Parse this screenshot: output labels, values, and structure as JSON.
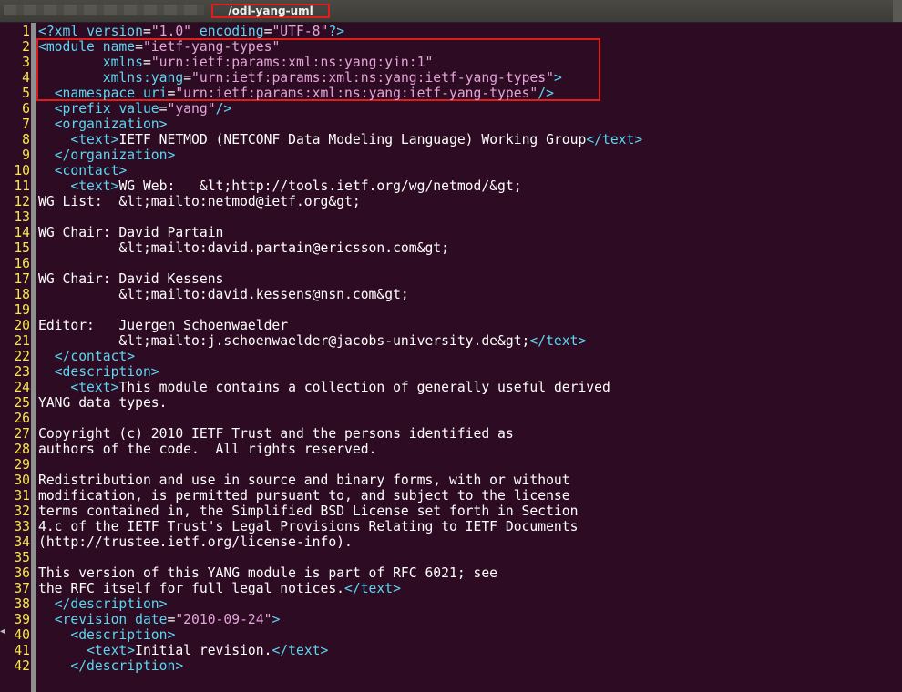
{
  "window": {
    "title": "/odl-yang-uml"
  },
  "lines": [
    {
      "n": "1",
      "parts": [
        [
          "pi",
          "<?xml "
        ],
        [
          "attr",
          "version"
        ],
        [
          "txt",
          "="
        ],
        [
          "str",
          "\"1.0\""
        ],
        [
          "txt",
          " "
        ],
        [
          "attr",
          "encoding"
        ],
        [
          "txt",
          "="
        ],
        [
          "str",
          "\"UTF-8\""
        ],
        [
          "pi",
          "?>"
        ]
      ]
    },
    {
      "n": "2",
      "parts": [
        [
          "tag",
          "<module "
        ],
        [
          "attr",
          "name"
        ],
        [
          "txt",
          "="
        ],
        [
          "str",
          "\"ietf-yang-types\""
        ]
      ]
    },
    {
      "n": "3",
      "parts": [
        [
          "txt",
          "        "
        ],
        [
          "attr",
          "xmlns"
        ],
        [
          "txt",
          "="
        ],
        [
          "str",
          "\"urn:ietf:params:xml:ns:yang:yin:1\""
        ]
      ]
    },
    {
      "n": "4",
      "parts": [
        [
          "txt",
          "        "
        ],
        [
          "attr",
          "xmlns:yang"
        ],
        [
          "txt",
          "="
        ],
        [
          "str",
          "\"urn:ietf:params:xml:ns:yang:ietf-yang-types\""
        ],
        [
          "tag",
          ">"
        ]
      ]
    },
    {
      "n": "5",
      "parts": [
        [
          "txt",
          "  "
        ],
        [
          "tag",
          "<namespace "
        ],
        [
          "attr",
          "uri"
        ],
        [
          "txt",
          "="
        ],
        [
          "str",
          "\"urn:ietf:params:xml:ns:yang:ietf-yang-types\""
        ],
        [
          "tag",
          "/>"
        ]
      ]
    },
    {
      "n": "6",
      "parts": [
        [
          "txt",
          "  "
        ],
        [
          "tag",
          "<prefix "
        ],
        [
          "attr",
          "value"
        ],
        [
          "txt",
          "="
        ],
        [
          "str",
          "\"yang\""
        ],
        [
          "tag",
          "/>"
        ]
      ]
    },
    {
      "n": "7",
      "parts": [
        [
          "txt",
          "  "
        ],
        [
          "tag",
          "<organization>"
        ]
      ]
    },
    {
      "n": "8",
      "parts": [
        [
          "txt",
          "    "
        ],
        [
          "tag",
          "<text>"
        ],
        [
          "txt",
          "IETF NETMOD (NETCONF Data Modeling Language) Working Group"
        ],
        [
          "tag",
          "</text>"
        ]
      ]
    },
    {
      "n": "9",
      "parts": [
        [
          "txt",
          "  "
        ],
        [
          "tag",
          "</organization>"
        ]
      ]
    },
    {
      "n": "10",
      "parts": [
        [
          "txt",
          "  "
        ],
        [
          "tag",
          "<contact>"
        ]
      ]
    },
    {
      "n": "11",
      "parts": [
        [
          "txt",
          "    "
        ],
        [
          "tag",
          "<text>"
        ],
        [
          "txt",
          "WG Web:   &lt;http://tools.ietf.org/wg/netmod/&gt;"
        ]
      ]
    },
    {
      "n": "12",
      "parts": [
        [
          "txt",
          "WG List:  &lt;mailto:netmod@ietf.org&gt;"
        ]
      ]
    },
    {
      "n": "13",
      "parts": [
        [
          "txt",
          ""
        ]
      ]
    },
    {
      "n": "14",
      "parts": [
        [
          "txt",
          "WG Chair: David Partain"
        ]
      ]
    },
    {
      "n": "15",
      "parts": [
        [
          "txt",
          "          &lt;mailto:david.partain@ericsson.com&gt;"
        ]
      ]
    },
    {
      "n": "16",
      "parts": [
        [
          "txt",
          ""
        ]
      ]
    },
    {
      "n": "17",
      "parts": [
        [
          "txt",
          "WG Chair: David Kessens"
        ]
      ]
    },
    {
      "n": "18",
      "parts": [
        [
          "txt",
          "          &lt;mailto:david.kessens@nsn.com&gt;"
        ]
      ]
    },
    {
      "n": "19",
      "parts": [
        [
          "txt",
          ""
        ]
      ]
    },
    {
      "n": "20",
      "parts": [
        [
          "txt",
          "Editor:   Juergen Schoenwaelder"
        ]
      ]
    },
    {
      "n": "21",
      "parts": [
        [
          "txt",
          "          &lt;mailto:j.schoenwaelder@jacobs-university.de&gt;"
        ],
        [
          "tag",
          "</text>"
        ]
      ]
    },
    {
      "n": "22",
      "parts": [
        [
          "txt",
          "  "
        ],
        [
          "tag",
          "</contact>"
        ]
      ]
    },
    {
      "n": "23",
      "parts": [
        [
          "txt",
          "  "
        ],
        [
          "tag",
          "<description>"
        ]
      ]
    },
    {
      "n": "24",
      "parts": [
        [
          "txt",
          "    "
        ],
        [
          "tag",
          "<text>"
        ],
        [
          "txt",
          "This module contains a collection of generally useful derived"
        ]
      ]
    },
    {
      "n": "25",
      "parts": [
        [
          "txt",
          "YANG data types."
        ]
      ]
    },
    {
      "n": "26",
      "parts": [
        [
          "txt",
          ""
        ]
      ]
    },
    {
      "n": "27",
      "parts": [
        [
          "txt",
          "Copyright (c) 2010 IETF Trust and the persons identified as"
        ]
      ]
    },
    {
      "n": "28",
      "parts": [
        [
          "txt",
          "authors of the code.  All rights reserved."
        ]
      ]
    },
    {
      "n": "29",
      "parts": [
        [
          "txt",
          ""
        ]
      ]
    },
    {
      "n": "30",
      "parts": [
        [
          "txt",
          "Redistribution and use in source and binary forms, with or without"
        ]
      ]
    },
    {
      "n": "31",
      "parts": [
        [
          "txt",
          "modification, is permitted pursuant to, and subject to the license"
        ]
      ]
    },
    {
      "n": "32",
      "parts": [
        [
          "txt",
          "terms contained in, the Simplified BSD License set forth in Section"
        ]
      ]
    },
    {
      "n": "33",
      "parts": [
        [
          "txt",
          "4.c of the IETF Trust's Legal Provisions Relating to IETF Documents"
        ]
      ]
    },
    {
      "n": "34",
      "parts": [
        [
          "txt",
          "(http://trustee.ietf.org/license-info)."
        ]
      ]
    },
    {
      "n": "35",
      "parts": [
        [
          "txt",
          ""
        ]
      ]
    },
    {
      "n": "36",
      "parts": [
        [
          "txt",
          "This version of this YANG module is part of RFC 6021; see"
        ]
      ]
    },
    {
      "n": "37",
      "parts": [
        [
          "txt",
          "the RFC itself for full legal notices."
        ],
        [
          "tag",
          "</text>"
        ]
      ]
    },
    {
      "n": "38",
      "parts": [
        [
          "txt",
          "  "
        ],
        [
          "tag",
          "</description>"
        ]
      ]
    },
    {
      "n": "39",
      "parts": [
        [
          "txt",
          "  "
        ],
        [
          "tag",
          "<revision "
        ],
        [
          "attr",
          "date"
        ],
        [
          "txt",
          "="
        ],
        [
          "str",
          "\"2010-09-24\""
        ],
        [
          "tag",
          ">"
        ]
      ]
    },
    {
      "n": "40",
      "parts": [
        [
          "txt",
          "    "
        ],
        [
          "tag",
          "<description>"
        ]
      ]
    },
    {
      "n": "41",
      "parts": [
        [
          "txt",
          "      "
        ],
        [
          "tag",
          "<text>"
        ],
        [
          "txt",
          "Initial revision."
        ],
        [
          "tag",
          "</text>"
        ]
      ]
    },
    {
      "n": "42",
      "parts": [
        [
          "txt",
          "    "
        ],
        [
          "tag",
          "</description>"
        ]
      ]
    }
  ]
}
